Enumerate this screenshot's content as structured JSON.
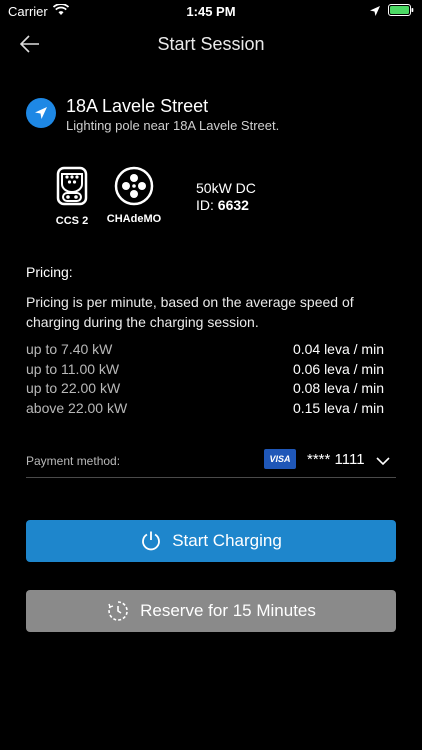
{
  "status_bar": {
    "carrier": "Carrier",
    "time": "1:45 PM"
  },
  "nav": {
    "title": "Start Session"
  },
  "location": {
    "name": "18A Lavele Street",
    "description": "Lighting pole near 18A Lavele Street."
  },
  "connectors": [
    {
      "label": "CCS 2"
    },
    {
      "label": "CHAdeMO"
    }
  ],
  "station": {
    "power": "50kW DC",
    "id_label": "ID:",
    "id_value": "6632"
  },
  "pricing": {
    "heading": "Pricing:",
    "description": "Pricing is per minute, based on the average speed of charging during the charging session.",
    "tiers": [
      {
        "label": "up to 7.40 kW",
        "price": "0.04 leva / min"
      },
      {
        "label": "up to 11.00 kW",
        "price": "0.06 leva / min"
      },
      {
        "label": "up to 22.00 kW",
        "price": "0.08 leva / min"
      },
      {
        "label": "above 22.00 kW",
        "price": "0.15 leva / min"
      }
    ]
  },
  "payment": {
    "label": "Payment method:",
    "card_brand": "VISA",
    "card_number": "**** 1111"
  },
  "buttons": {
    "start": "Start Charging",
    "reserve": "Reserve for 15 Minutes"
  },
  "colors": {
    "accent": "#1e86cc",
    "disabled": "#8a8a8a",
    "background": "#000000"
  }
}
